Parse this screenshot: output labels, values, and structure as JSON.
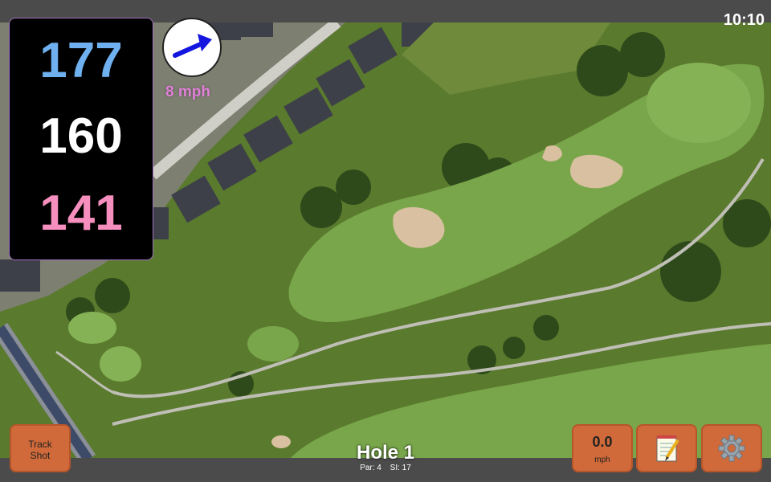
{
  "status": {
    "time": "10:10"
  },
  "distances": {
    "back": "177",
    "middle": "160",
    "front": "141"
  },
  "wind": {
    "speed_label": "8 mph",
    "icon": "wind-direction-arrow-icon",
    "color": "#e07fd8"
  },
  "buttons": {
    "track_shot": {
      "line1": "Track",
      "line2": "Shot"
    },
    "speed": {
      "value": "0.0",
      "unit": "mph"
    },
    "notes_icon": "notepad-icon",
    "settings_icon": "gear-icon"
  },
  "hole": {
    "title": "Hole 1",
    "par": "Par: 4",
    "si": "SI: 17"
  },
  "colors": {
    "button": "#d06a3a",
    "back": "#6fb1f0",
    "middle": "#ffffff",
    "front": "#f68fbe",
    "bar": "#4b4b4b"
  }
}
